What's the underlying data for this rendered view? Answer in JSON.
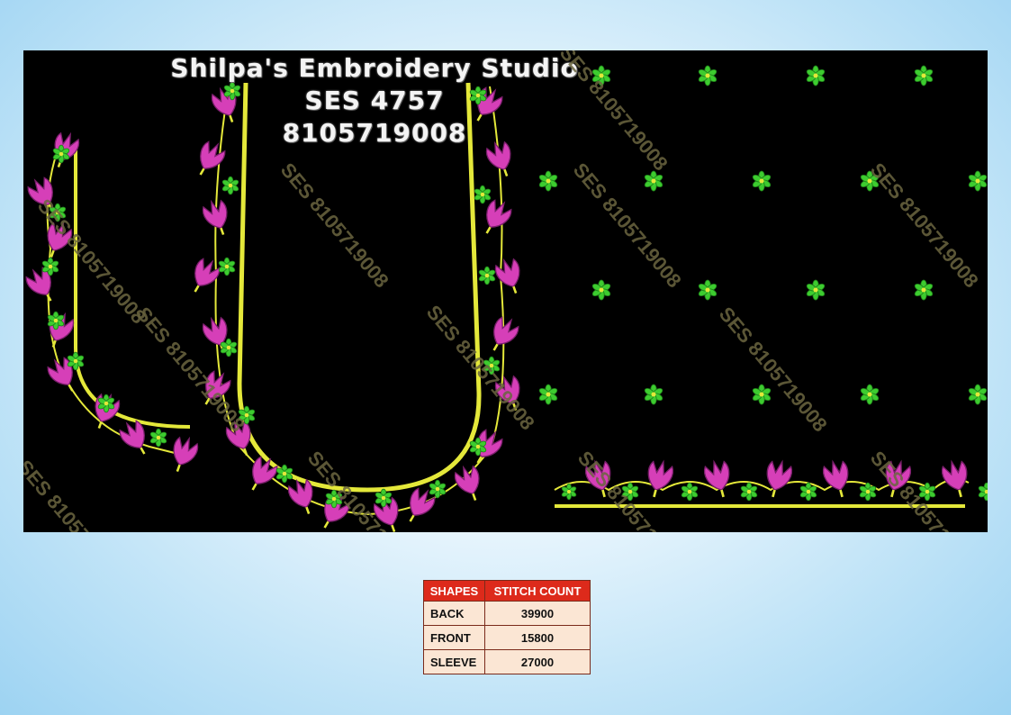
{
  "title": {
    "studio_name": "Shilpa's Embroidery Studio",
    "design_code": "SES  4757",
    "phone": "8105719008"
  },
  "watermark_text": "SES 8105719008",
  "colors": {
    "background": "#000000",
    "flower_petal": "#d63fb8",
    "leaf": "#3dcc2f",
    "border_line": "#e4e83a",
    "table_header": "#dd2a1b",
    "table_cell": "#fbe6d4"
  },
  "stitch_table": {
    "headers": [
      "SHAPES",
      "STITCH COUNT"
    ],
    "rows": [
      {
        "shape": "BACK",
        "count": "39900"
      },
      {
        "shape": "FRONT",
        "count": "15800"
      },
      {
        "shape": "SLEEVE",
        "count": "27000"
      }
    ]
  }
}
